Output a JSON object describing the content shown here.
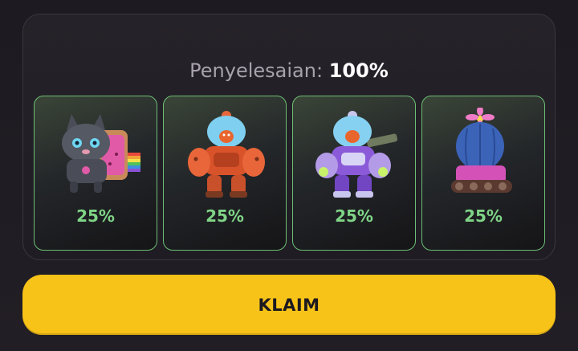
{
  "completion": {
    "label": "Penyelesaian:",
    "value": "100%"
  },
  "rewards": [
    {
      "icon": "nyan-cat-robot-icon",
      "percent": "25%"
    },
    {
      "icon": "orange-mech-robot-icon",
      "percent": "25%"
    },
    {
      "icon": "purple-mech-robot-icon",
      "percent": "25%"
    },
    {
      "icon": "cactus-tank-icon",
      "percent": "25%"
    }
  ],
  "claim_button": {
    "label": "KLAIM"
  },
  "colors": {
    "accent_green": "#7fd487",
    "card_border": "#6bbf74",
    "button_yellow": "#f8c318",
    "background": "#1e1b22"
  }
}
